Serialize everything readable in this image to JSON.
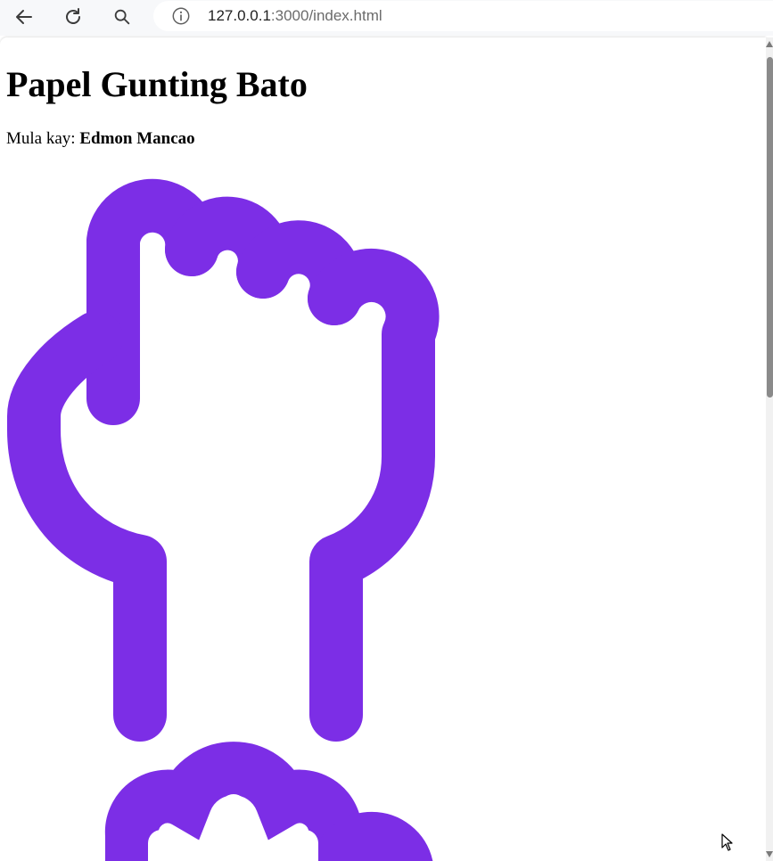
{
  "browser": {
    "url_host": "127.0.0.1",
    "url_rest": ":3000/index.html",
    "icons": [
      "back-icon",
      "reload-icon",
      "search-icon",
      "info-icon"
    ]
  },
  "page": {
    "title": "Papel Gunting Bato",
    "byline_prefix": "Mula kay:",
    "author": "Edmon Mancao",
    "accent_color": "#7c2ee6"
  },
  "images": [
    {
      "name": "rock-hand-image",
      "icon": "raised-fist-icon"
    },
    {
      "name": "paper-hand-image",
      "icon": "hand-icon"
    }
  ]
}
